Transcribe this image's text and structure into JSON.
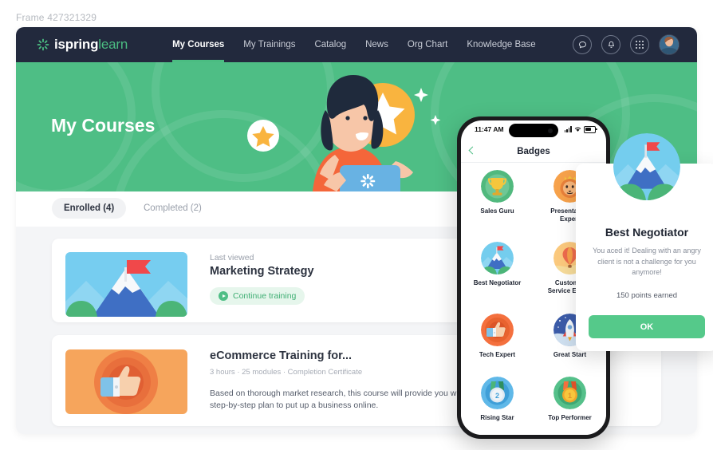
{
  "frame_label": "Frame 427321329",
  "colors": {
    "nav_bg": "#22293d",
    "brand_green": "#4ebe85",
    "accent_green": "#55c98a",
    "page_bg": "#f4f5f7"
  },
  "topnav": {
    "logo_name": "ispring",
    "logo_product": "learn",
    "items": [
      {
        "label": "My Courses",
        "active": true
      },
      {
        "label": "My Trainings",
        "active": false
      },
      {
        "label": "Catalog",
        "active": false
      },
      {
        "label": "News",
        "active": false
      },
      {
        "label": "Org Chart",
        "active": false
      },
      {
        "label": "Knowledge Base",
        "active": false
      }
    ],
    "icons": [
      "chat-bubble-icon",
      "bell-icon",
      "apps-grid-icon",
      "user-avatar"
    ]
  },
  "hero": {
    "title": "My Courses"
  },
  "tabs": [
    {
      "label": "Enrolled (4)",
      "active": true
    },
    {
      "label": "Completed (2)",
      "active": false
    }
  ],
  "courses": [
    {
      "eyebrow": "Last viewed",
      "title": "Marketing Strategy",
      "button": "Continue training",
      "thumb": "mountain-flag-image"
    },
    {
      "title": "eCommerce Training for...",
      "meta": "3 hours · 25 modules  ·  Completion Certificate",
      "description": "Based on thorough market research, this course will provide you with a step-by-step plan to put up a business online.",
      "thumb": "thumbs-up-image"
    }
  ],
  "phone": {
    "status": {
      "time": "11:47 AM",
      "signal": "signal-bars-icon",
      "wifi": "wifi-icon",
      "battery": "battery-icon"
    },
    "header_title": "Badges",
    "back": "back-chevron-icon",
    "badges": [
      {
        "label": "Sales Guru",
        "icon": "trophy-badge"
      },
      {
        "label": "Presentation Expert",
        "icon": "lion-badge"
      },
      {
        "label": "Best Negotiator",
        "icon": "mountain-badge"
      },
      {
        "label": "Customer Service Expert",
        "icon": "balloon-badge"
      },
      {
        "label": "Tech Expert",
        "icon": "thumbs-up-badge"
      },
      {
        "label": "Great Start",
        "icon": "rocket-badge"
      },
      {
        "label": "Rising Star",
        "icon": "medal-2-badge"
      },
      {
        "label": "Top Performer",
        "icon": "medal-1-badge"
      }
    ]
  },
  "popup": {
    "badge_icon": "mountain-badge",
    "title": "Best Negotiator",
    "description": "You aced it! Dealing with an angry client is not a challenge for you anymore!",
    "points": "150 points earned",
    "ok_label": "OK"
  }
}
